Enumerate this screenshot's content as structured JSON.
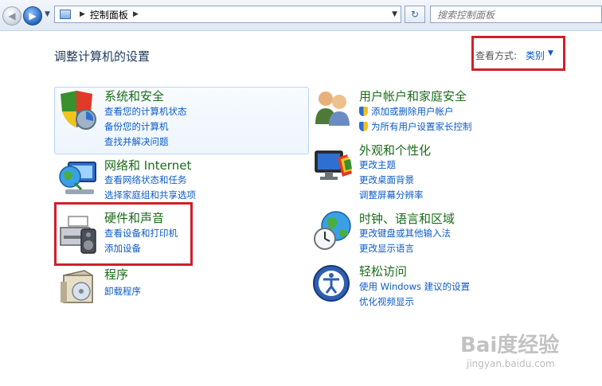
{
  "addressbar": {
    "path": "控制面板",
    "search_placeholder": "搜索控制面板"
  },
  "content": {
    "heading": "调整计算机的设置",
    "view_by_label": "查看方式:",
    "view_by_value": "类别"
  },
  "categories": [
    {
      "title": "系统和安全",
      "links": [
        "查看您的计算机状态",
        "备份您的计算机",
        "查找并解决问题"
      ]
    },
    {
      "title": "网络和 Internet",
      "links": [
        "查看网络状态和任务",
        "选择家庭组和共享选项"
      ]
    },
    {
      "title": "硬件和声音",
      "links": [
        "查看设备和打印机",
        "添加设备"
      ]
    },
    {
      "title": "程序",
      "links": [
        "卸载程序"
      ]
    },
    {
      "title": "用户帐户和家庭安全",
      "links": [
        "添加或删除用户帐户",
        "为所有用户设置家长控制"
      ]
    },
    {
      "title": "外观和个性化",
      "links": [
        "更改主题",
        "更改桌面背景",
        "调整屏幕分辨率"
      ]
    },
    {
      "title": "时钟、语言和区域",
      "links": [
        "更改键盘或其他输入法",
        "更改显示语言"
      ]
    },
    {
      "title": "轻松访问",
      "links": [
        "使用 Windows 建议的设置",
        "优化视频显示"
      ]
    }
  ],
  "watermark": {
    "logo": "Bai度经验",
    "url": "jingyan.baidu.com"
  },
  "colors": {
    "title_green": "#1a6b1a",
    "link_blue": "#0d5bc6",
    "highlight_red": "#d0202a"
  }
}
